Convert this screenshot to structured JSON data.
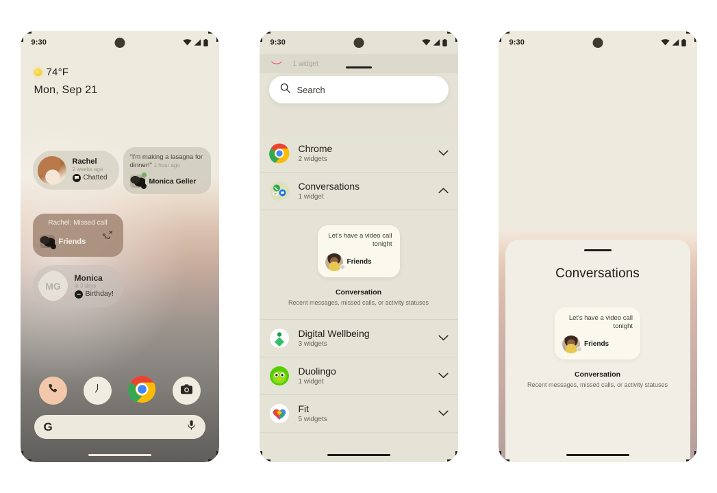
{
  "screens": {
    "home": {
      "name": "android-home-screen",
      "status_bar": {
        "time": "9:30",
        "icons": [
          "wifi-icon",
          "signal-icon",
          "battery-icon"
        ]
      },
      "at_a_glance": {
        "weather_icon": "sun-icon",
        "temperature": "74°F",
        "date": "Mon, Sep 21"
      },
      "widgets": [
        {
          "id": "rachel-chatted",
          "name": "Rachel",
          "timestamp": "2 weeks ago",
          "status": "Chatted",
          "badge_icon": "message-bubble-icon",
          "avatar": "rachel-avatar"
        },
        {
          "id": "monica-geller-status",
          "quote": "\"I'm making a lasagna for dinner!\"",
          "timestamp": "1 hour ago",
          "name": "Monica Geller",
          "avatar": "cat-avatar",
          "online_dot": "online-status-dot"
        },
        {
          "id": "rachel-missed-call",
          "title": "Rachel: Missed call",
          "group": "Friends",
          "icon": "missed-call-icon",
          "avatar": "friends-avatar"
        },
        {
          "id": "monica-birthday",
          "name": "Monica",
          "timestamp": "in 3 days",
          "status": "Birthday!",
          "initials": "MG",
          "badge_icon": "birthday-badge-icon"
        }
      ],
      "dock": [
        {
          "id": "phone",
          "icon": "phone-icon",
          "label": "Phone"
        },
        {
          "id": "clock",
          "icon": "clock-icon",
          "label": "Clock"
        },
        {
          "id": "chrome",
          "icon": "chrome-icon",
          "label": "Chrome"
        },
        {
          "id": "camera",
          "icon": "camera-icon",
          "label": "Camera"
        }
      ],
      "search_pill": {
        "logo": "G",
        "mic_icon": "microphone-icon"
      }
    },
    "widget_picker": {
      "name": "widget-picker-screen",
      "status_bar": {
        "time": "9:30"
      },
      "search": {
        "placeholder": "Search",
        "icon": "search-icon"
      },
      "partial_top_row": {
        "count": "1 widget",
        "icon": "app-icon"
      },
      "apps": [
        {
          "id": "chrome",
          "name": "Chrome",
          "count": "2 widgets",
          "icon": "chrome-icon",
          "expanded": false,
          "chevron": "chevron-down-icon"
        },
        {
          "id": "conversations",
          "name": "Conversations",
          "count": "1 widget",
          "icon": "conversations-icon",
          "expanded": true,
          "chevron": "chevron-up-icon"
        },
        {
          "id": "digital-wellbeing",
          "name": "Digital Wellbeing",
          "count": "3 widgets",
          "icon": "digital-wellbeing-icon",
          "expanded": false,
          "chevron": "chevron-down-icon"
        },
        {
          "id": "duolingo",
          "name": "Duolingo",
          "count": "1 widget",
          "icon": "duolingo-icon",
          "expanded": false,
          "chevron": "chevron-down-icon"
        },
        {
          "id": "fit",
          "name": "Fit",
          "count": "5 widgets",
          "icon": "fit-icon",
          "expanded": false,
          "chevron": "chevron-down-icon"
        }
      ],
      "preview": {
        "message": "Let's have a video call tonight",
        "contact": "Friends",
        "title": "Conversation",
        "description": "Recent messages, missed calls, or activity statuses"
      }
    },
    "bottom_sheet": {
      "name": "conversations-bottom-sheet",
      "status_bar": {
        "time": "9:30"
      },
      "title": "Conversations",
      "preview": {
        "message": "Let's have a video call tonight",
        "contact": "Friends",
        "title": "Conversation",
        "description": "Recent messages, missed calls, or activity statuses"
      }
    }
  },
  "colors": {
    "surface": "#e5e2d6",
    "sheet": "#f1efe5",
    "wallpaper_top": "#efeade",
    "accent_green": "#34a853",
    "accent_blue": "#4285f4",
    "accent_red": "#ea4335",
    "accent_yellow": "#fbbc05",
    "text_primary": "#1d1c18",
    "text_secondary": "#6a665c"
  }
}
